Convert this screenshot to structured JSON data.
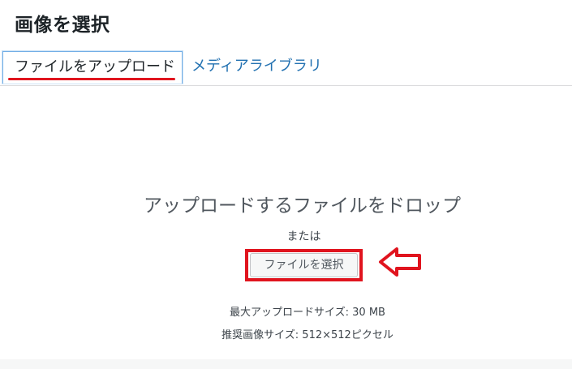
{
  "header": {
    "title": "画像を選択"
  },
  "tabs": [
    {
      "label": "ファイルをアップロード",
      "active": true
    },
    {
      "label": "メディアライブラリ",
      "active": false
    }
  ],
  "uploader": {
    "drop_instructions": "アップロードするファイルをドロップ",
    "or_text": "または",
    "select_button_label": "ファイルを選択",
    "max_upload_size": "最大アップロードサイズ: 30 MB",
    "recommended_size": "推奨画像サイズ: 512×512ピクセル"
  },
  "annotations": {
    "highlight_color": "#e0141e",
    "arrow_icon": "left-arrow-outline-icon"
  },
  "colors": {
    "link_blue": "#2271b1",
    "active_tab_border": "#72aee6"
  }
}
